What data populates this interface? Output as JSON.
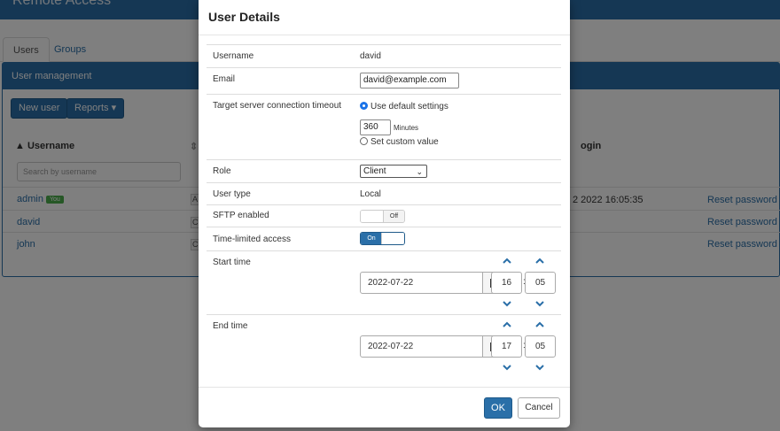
{
  "app": {
    "title": "Remote Access"
  },
  "tabs": [
    {
      "label": "Users"
    },
    {
      "label": "Groups"
    }
  ],
  "panel": {
    "heading": "User management",
    "new_user": "New user",
    "reports": "Reports ▾"
  },
  "table": {
    "username_header": "▲ Username",
    "last_login_header": "ogin",
    "search_placeholder": "Search by username",
    "rows": [
      {
        "username": "admin",
        "badge": "You",
        "stub": "A",
        "last_login": "2 2022 16:05:35",
        "action": "Reset password"
      },
      {
        "username": "david",
        "stub": "C",
        "action": "Reset password"
      },
      {
        "username": "john",
        "stub": "C",
        "action": "Reset password"
      }
    ]
  },
  "modal": {
    "title": "User Details",
    "username_label": "Username",
    "username_value": "david",
    "email_label": "Email",
    "email_value": "david@example.com",
    "timeout_label": "Target server connection timeout",
    "timeout_default": "Use default settings",
    "timeout_minutes": "360",
    "minutes_label": "Minutes",
    "timeout_custom": "Set custom value",
    "role_label": "Role",
    "role_value": "Client",
    "user_type_label": "User type",
    "user_type_value": "Local",
    "sftp_label": "SFTP enabled",
    "sftp_state": "Off",
    "time_limited_label": "Time-limited access",
    "time_limited_state": "On",
    "start_label": "Start time",
    "start_date": "2022-07-22",
    "start_hour": "16",
    "start_minute": "05",
    "end_label": "End time",
    "end_date": "2022-07-22",
    "end_hour": "17",
    "end_minute": "05",
    "ok": "OK",
    "cancel": "Cancel"
  },
  "colors": {
    "primary": "#2a6fa8",
    "radio_checked": "#1a73e8"
  }
}
